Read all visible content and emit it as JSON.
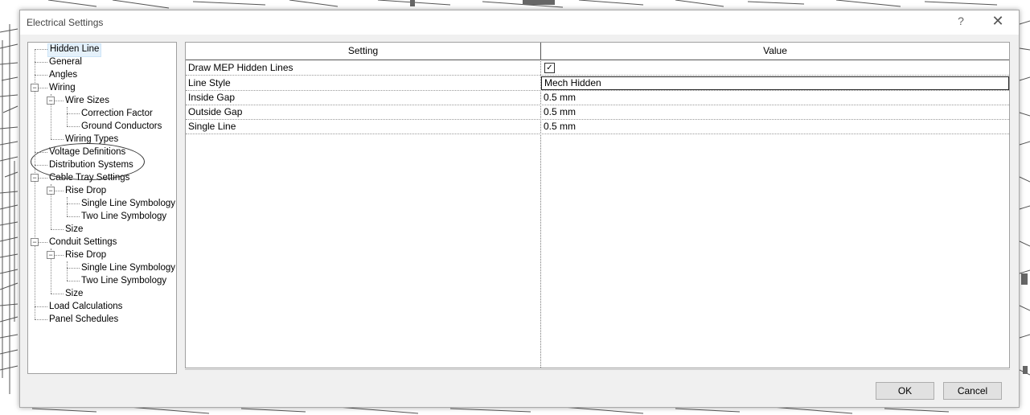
{
  "dialog": {
    "title": "Electrical Settings",
    "help_glyph": "?",
    "close_glyph": "✕"
  },
  "tree": {
    "items": [
      {
        "label": "Hidden Line",
        "selected": true
      },
      {
        "label": "General"
      },
      {
        "label": "Angles"
      },
      {
        "label": "Wiring",
        "toggle": "−"
      },
      {
        "label": "Wire Sizes",
        "toggle": "−"
      },
      {
        "label": "Correction Factor"
      },
      {
        "label": "Ground Conductors"
      },
      {
        "label": "Wiring Types"
      },
      {
        "label": "Voltage Definitions"
      },
      {
        "label": "Distribution Systems"
      },
      {
        "label": "Cable Tray Settings",
        "toggle": "−"
      },
      {
        "label": "Rise Drop",
        "toggle": "−"
      },
      {
        "label": "Single Line Symbology"
      },
      {
        "label": "Two Line Symbology"
      },
      {
        "label": "Size"
      },
      {
        "label": "Conduit Settings",
        "toggle": "−"
      },
      {
        "label": "Rise Drop",
        "toggle": "−"
      },
      {
        "label": "Single Line Symbology"
      },
      {
        "label": "Two Line Symbology"
      },
      {
        "label": "Size"
      },
      {
        "label": "Load Calculations"
      },
      {
        "label": "Panel Schedules"
      }
    ]
  },
  "table": {
    "headers": {
      "setting": "Setting",
      "value": "Value"
    },
    "rows": [
      {
        "setting": "Draw MEP Hidden Lines",
        "value": "",
        "checkbox": "✓"
      },
      {
        "setting": "Line Style",
        "value": "Mech Hidden",
        "editing": true
      },
      {
        "setting": "Inside Gap",
        "value": "0.5 mm"
      },
      {
        "setting": "Outside Gap",
        "value": "0.5 mm"
      },
      {
        "setting": "Single Line",
        "value": "0.5 mm"
      }
    ]
  },
  "buttons": {
    "ok": "OK",
    "cancel": "Cancel"
  }
}
